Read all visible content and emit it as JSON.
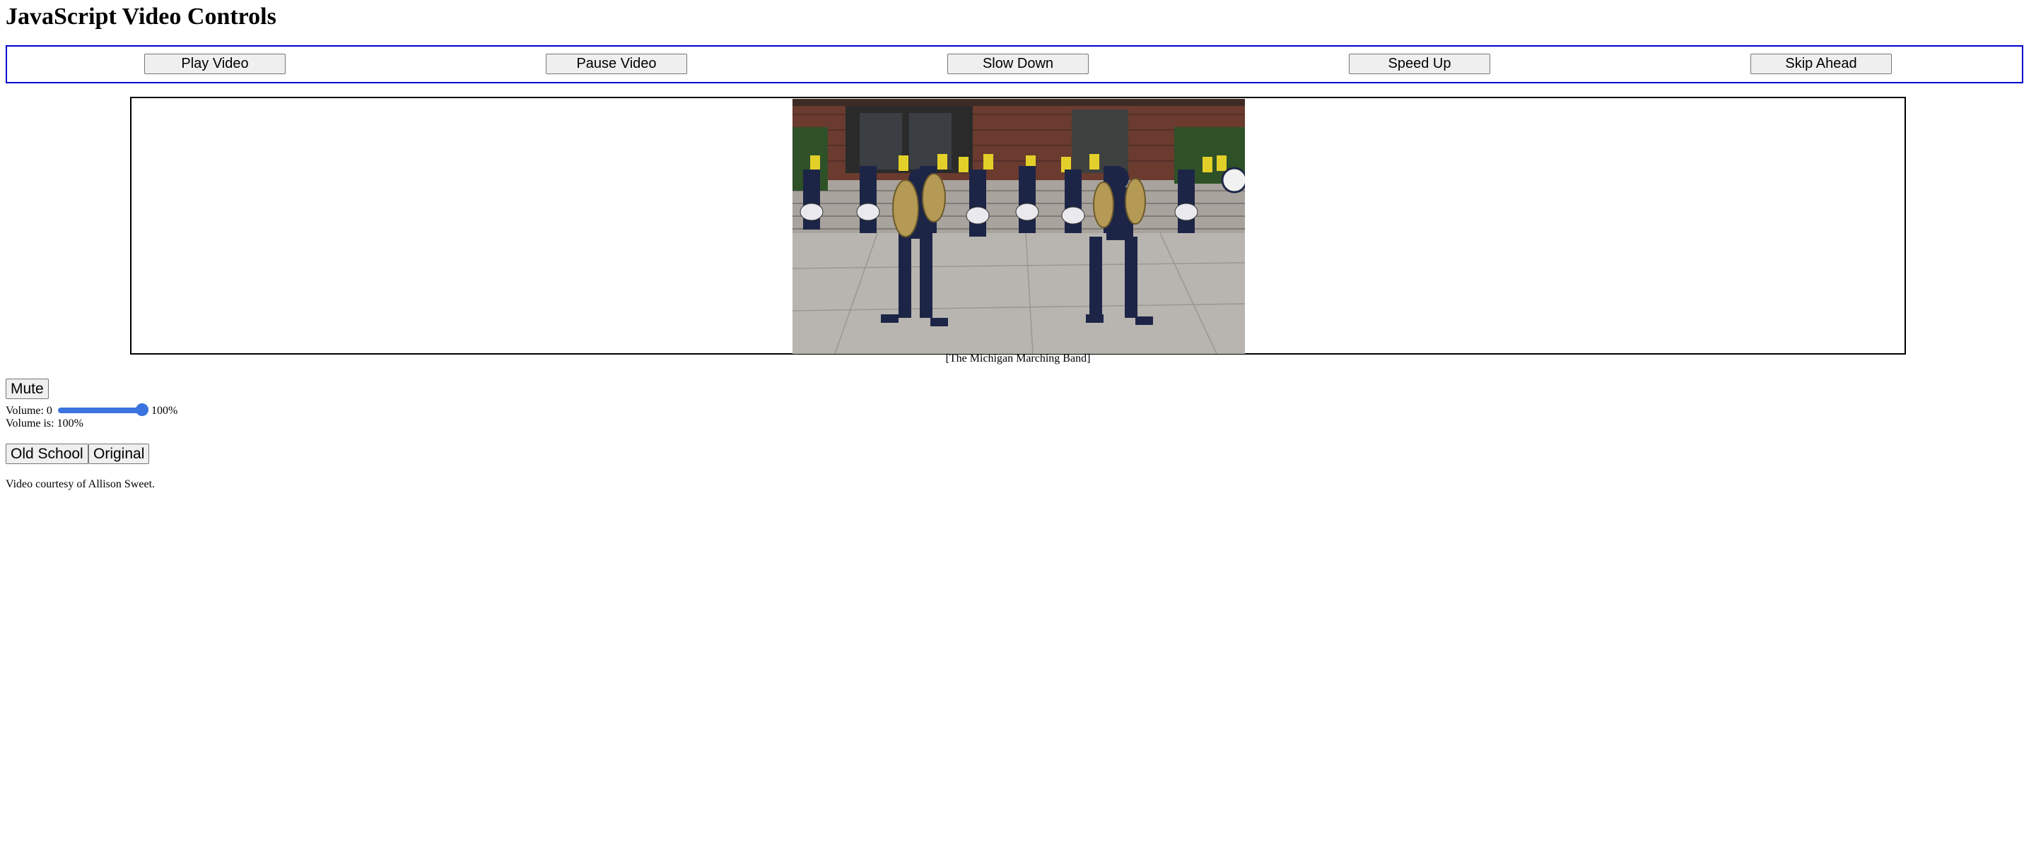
{
  "page": {
    "title": "JavaScript Video Controls"
  },
  "controls": {
    "play": "Play Video",
    "pause": "Pause Video",
    "slow": "Slow Down",
    "speed": "Speed Up",
    "skip": "Skip Ahead"
  },
  "video": {
    "caption": "[The Michigan Marching Band]"
  },
  "audio": {
    "mute_label": "Mute",
    "volume_label": "Volume: 0",
    "volume_max_label": "100%",
    "volume_value": 1.0,
    "volume_status": "Volume is: 100%"
  },
  "filters": {
    "old_school": "Old School",
    "original": "Original"
  },
  "credit": "Video courtesy of Allison Sweet.",
  "colors": {
    "controls_border": "#0000cc",
    "slider_accent": "#3b73e0"
  }
}
